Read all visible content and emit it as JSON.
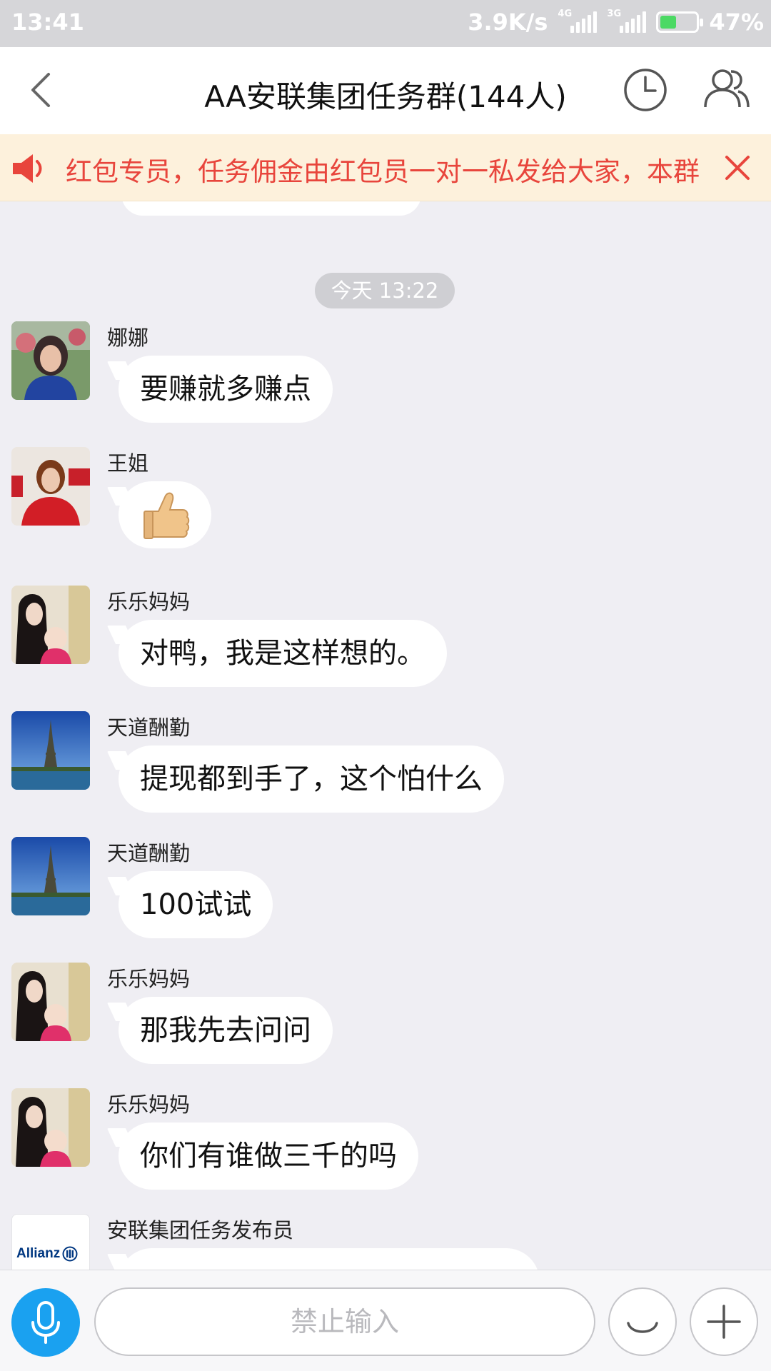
{
  "status_bar": {
    "time": "13:41",
    "speed": "3.9K/s",
    "net1": "4G",
    "net2": "3G",
    "battery": "47%"
  },
  "header": {
    "title": "AA安联集团任务群(144人)"
  },
  "notice": {
    "text": "红包专员，任务佣金由红包员一对一私发给大家，本群"
  },
  "timestamp": "今天 13:22",
  "messages": [
    {
      "sender": "娜娜",
      "text": "要赚就多赚点",
      "avatar": "portrait-woman-blue"
    },
    {
      "sender": "王姐",
      "text": "👍",
      "avatar": "portrait-woman-red-scarf"
    },
    {
      "sender": "乐乐妈妈",
      "text": "对鸭，我是这样想的。",
      "avatar": "portrait-mother-baby"
    },
    {
      "sender": "天道酬勤",
      "text": "提现都到手了，这个怕什么",
      "avatar": "eiffel-tower"
    },
    {
      "sender": "天道酬勤",
      "text": "100试试",
      "avatar": "eiffel-tower"
    },
    {
      "sender": "乐乐妈妈",
      "text": "那我先去问问",
      "avatar": "portrait-mother-baby"
    },
    {
      "sender": "乐乐妈妈",
      "text": "你们有谁做三千的吗",
      "avatar": "portrait-mother-baby"
    },
    {
      "sender": "安联集团任务发布员",
      "text": "",
      "avatar": "allianz-logo",
      "avatar_text": "Allianz"
    }
  ],
  "input": {
    "placeholder": "禁止输入"
  },
  "colors": {
    "accent": "#1aa1f0",
    "notice_text": "#e8453c",
    "notice_bg": "#fdf1dc",
    "chat_bg": "#efeef3"
  }
}
